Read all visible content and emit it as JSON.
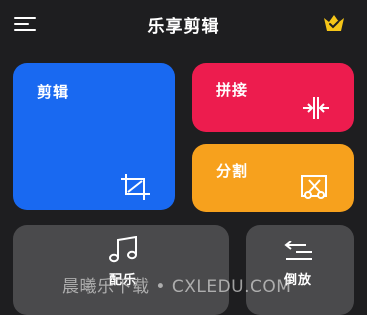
{
  "app": {
    "title": "乐享剪辑"
  },
  "header": {
    "menu_icon": "hamburger-menu-icon",
    "vip_icon": "crown-icon"
  },
  "cards": {
    "edit": {
      "label": "剪辑",
      "icon": "crop-icon",
      "color": "#1969f1"
    },
    "join": {
      "label": "拼接",
      "icon": "merge-icon",
      "color": "#ed1c4e"
    },
    "split": {
      "label": "分割",
      "icon": "cut-icon",
      "color": "#f7a11d"
    },
    "music": {
      "label": "配乐",
      "icon": "music-note-icon",
      "color": "#4a4a4c"
    },
    "reverse": {
      "label": "倒放",
      "icon": "reverse-icon",
      "color": "#4a4a4c"
    }
  },
  "watermark": "晨曦乐下载 • CXLEDU.COM"
}
